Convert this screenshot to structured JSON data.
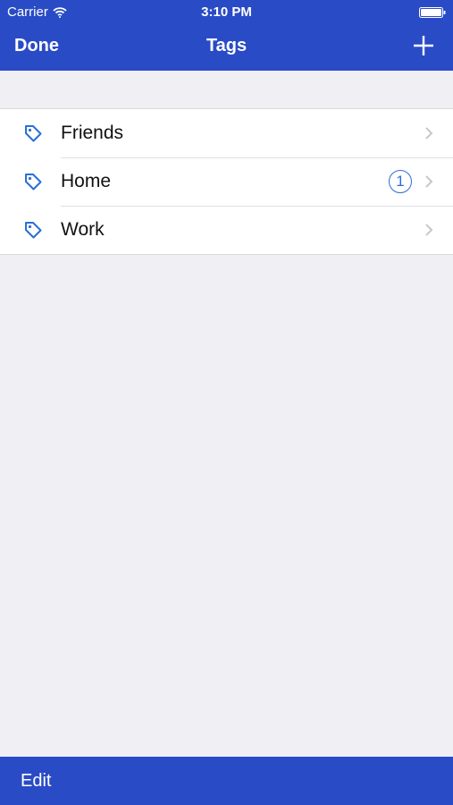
{
  "colors": {
    "accent": "#2a4bc6",
    "tag_icon": "#2a6fd6",
    "background": "#efeff4"
  },
  "status_bar": {
    "carrier": "Carrier",
    "time": "3:10 PM",
    "icons": [
      "wifi-icon",
      "battery-icon"
    ]
  },
  "nav_bar": {
    "done_label": "Done",
    "title": "Tags",
    "add_icon": "plus-icon"
  },
  "tags": [
    {
      "label": "Friends",
      "count": "",
      "icon": "tag-icon"
    },
    {
      "label": "Home",
      "count": "1",
      "icon": "tag-icon"
    },
    {
      "label": "Work",
      "count": "",
      "icon": "tag-icon"
    }
  ],
  "toolbar": {
    "edit_label": "Edit"
  }
}
